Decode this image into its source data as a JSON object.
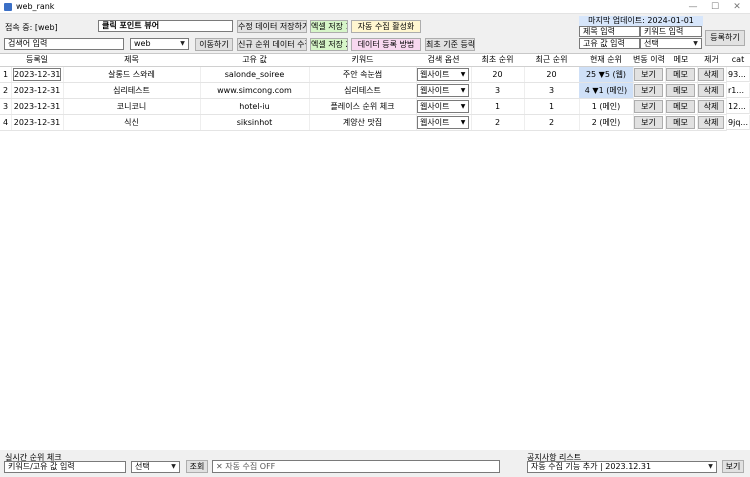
{
  "window": {
    "title": "web_rank",
    "minimize": "—",
    "maximize": "☐",
    "close": "✕"
  },
  "top": {
    "connect_label": "접속 중: [web]",
    "viewer_title": "클릭 포인트 뷰어",
    "btn_save_modified": "수정 데이터 저장하기",
    "btn_excel_save1": "엑셀 저장 1",
    "btn_auto_collect": "자동 수집 활성화",
    "search_input": "검색어 입력",
    "site_select": "web",
    "btn_goto": "이동하기",
    "btn_new_rank": "신규 순위 데이터 수집",
    "btn_excel_save2": "엑셀 저장 2",
    "btn_register_method": "데이터 등록 방법",
    "btn_initial_order": "최초 기준 등락폭",
    "last_update": "마지막 업데이트: 2024-01-01",
    "title_input": "제목 입력",
    "keyword_input": "키워드 입력",
    "unique_input": "고유 값 입력",
    "select_placeholder": "선택",
    "btn_register": "등록하기"
  },
  "table": {
    "headers": [
      "등록일",
      "제목",
      "고유 값",
      "키워드",
      "검색 옵션",
      "최초 순위",
      "최근 순위",
      "현재 순위",
      "변동 이력",
      "메모",
      "제거",
      "cat"
    ],
    "rows": [
      {
        "num": "1",
        "date": "2023-12-31",
        "title": "살롱드 스와레",
        "unique": "salonde_soiree",
        "keyword": "주안 속눈썹",
        "option": "웹사이트",
        "first": "20",
        "recent": "20",
        "current": "25 ▼5 (웹)",
        "history": "보기",
        "memo": "메모",
        "remove": "삭제",
        "cat": "93..."
      },
      {
        "num": "2",
        "date": "2023-12-31",
        "title": "심리테스트",
        "unique": "www.simcong.com",
        "keyword": "심리테스트",
        "option": "웹사이트",
        "first": "3",
        "recent": "3",
        "current": "4 ▼1 (메인)",
        "history": "보기",
        "memo": "메모",
        "remove": "삭제",
        "cat": "r1..."
      },
      {
        "num": "3",
        "date": "2023-12-31",
        "title": "코니코니",
        "unique": "hotel-iu",
        "keyword": "플레이스 순위 체크",
        "option": "웹사이트",
        "first": "1",
        "recent": "1",
        "current": "1 (메인)",
        "history": "보기",
        "memo": "메모",
        "remove": "삭제",
        "cat": "12..."
      },
      {
        "num": "4",
        "date": "2023-12-31",
        "title": "식신",
        "unique": "siksinhot",
        "keyword": "계양산 맛집",
        "option": "웹사이트",
        "first": "2",
        "recent": "2",
        "current": "2 (메인)",
        "history": "보기",
        "memo": "메모",
        "remove": "삭제",
        "cat": "9jq..."
      }
    ]
  },
  "footer": {
    "realtime_label": "실시간 순위 체크",
    "realtime_input": "키워드/고유 값 입력",
    "select": "선택",
    "btn_query": "조회",
    "auto_collect_status": "✕ 자동 수집 OFF",
    "notice_label": "공지사항 리스트",
    "notice_select": "자동 수집 기능 추가 | 2023.12.31",
    "btn_view": "보기"
  },
  "colors": {
    "highlight": "#cfe0f7",
    "excel_btn": "#d6f5c8",
    "register_btn": "#f8d8f0",
    "auto_btn": "#fff6d0",
    "update_header": "#d7e6fb"
  }
}
